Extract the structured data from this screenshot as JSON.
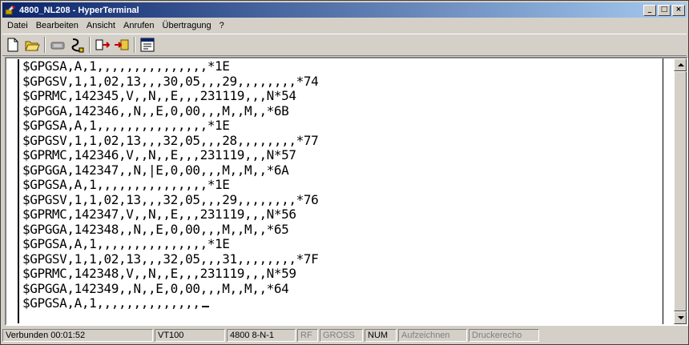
{
  "window": {
    "title": "4800_NL208 - HyperTerminal",
    "minimize_glyph": "_",
    "maximize_glyph": "□",
    "close_glyph": "×"
  },
  "menu": [
    "Datei",
    "Bearbeiten",
    "Ansicht",
    "Anrufen",
    "Übertragung",
    "?"
  ],
  "toolbar": {
    "buttons": [
      "new-icon",
      "open-icon",
      "connect-icon",
      "disconnect-icon",
      "send-icon",
      "receive-icon",
      "properties-icon"
    ]
  },
  "terminal": {
    "lines": [
      "$GPGSA,A,1,,,,,,,,,,,,,,,*1E",
      "$GPGSV,1,1,02,13,,,30,05,,,29,,,,,,,,*74",
      "$GPRMC,142345,V,,N,,E,,,231119,,,N*54",
      "$GPGGA,142346,,N,,E,0,00,,,M,,M,,*6B",
      "$GPGSA,A,1,,,,,,,,,,,,,,,*1E",
      "$GPGSV,1,1,02,13,,,32,05,,,28,,,,,,,,*77",
      "$GPRMC,142346,V,,N,,E,,,231119,,,N*57",
      "$GPGGA,142347,,N,|E,0,00,,,M,,M,,*6A",
      "$GPGSA,A,1,,,,,,,,,,,,,,,*1E",
      "$GPGSV,1,1,02,13,,,32,05,,,29,,,,,,,,*76",
      "$GPRMC,142347,V,,N,,E,,,231119,,,N*56",
      "$GPGGA,142348,,N,,E,0,00,,,M,,M,,*65",
      "$GPGSA,A,1,,,,,,,,,,,,,,,*1E",
      "$GPGSV,1,1,02,13,,,32,05,,,31,,,,,,,,*7F",
      "$GPRMC,142348,V,,N,,E,,,231119,,,N*59",
      "$GPGGA,142349,,N,,E,0,00,,,M,,M,,*64",
      "$GPGSA,A,1,,,,,,,,,,,,,,"
    ]
  },
  "status": {
    "connected": "Verbunden 00:01:52",
    "emulation": "VT100",
    "port_settings": "4800 8-N-1",
    "rf": "RF",
    "caps": "GROSS",
    "num": "NUM",
    "capture": "Aufzeichnen",
    "print_echo": "Druckerecho"
  },
  "colors": {
    "titlebar_start": "#0a246a",
    "titlebar_end": "#a6caf0",
    "face": "#d4d0c8"
  }
}
